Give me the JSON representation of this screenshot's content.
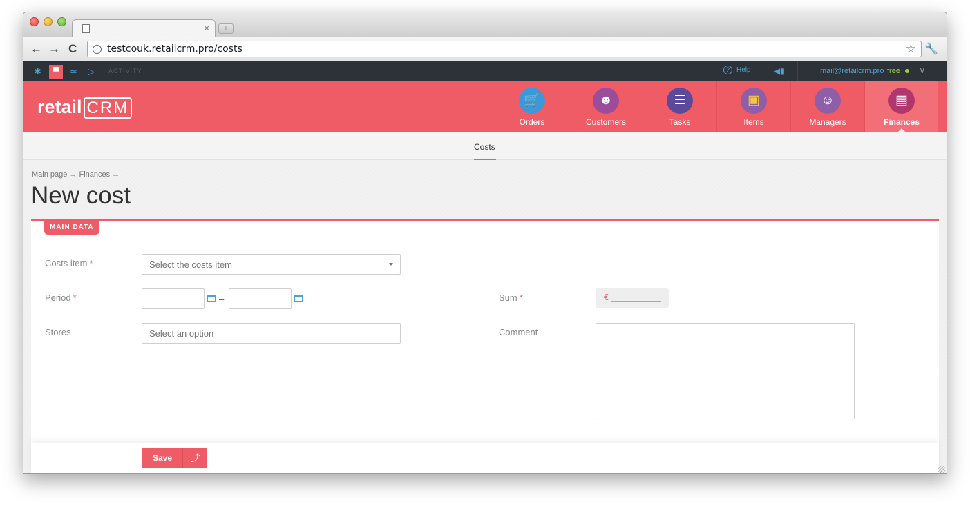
{
  "browser": {
    "url": "testcouk.retailcrm.pro/costs",
    "new_tab_glyph": "+",
    "close_glyph": "×"
  },
  "topbar": {
    "activity_label": "ACTIVITY",
    "help_label": "Help",
    "email": "mail@retailcrm.pro",
    "plan": "free",
    "accent_color": "#4aa3d8"
  },
  "header": {
    "logo_text": "retail",
    "logo_crm": "CRM",
    "brand_color": "#ef5c66",
    "nav": [
      {
        "label": "Orders",
        "icon": "cart-icon",
        "color": "#3a9ad9"
      },
      {
        "label": "Customers",
        "icon": "person-icon",
        "color": "#9b4d9b"
      },
      {
        "label": "Tasks",
        "icon": "chat-list-icon",
        "color": "#5b4a9c"
      },
      {
        "label": "Items",
        "icon": "box-icon",
        "color": "#8e5ea9"
      },
      {
        "label": "Managers",
        "icon": "manager-icon",
        "color": "#8e5ea9"
      },
      {
        "label": "Finances",
        "icon": "finance-list-icon",
        "color": "#b2366e"
      }
    ]
  },
  "subnav": {
    "costs": "Costs"
  },
  "page": {
    "breadcrumb": "Main page → Finances →",
    "title": "New cost",
    "section": "MAIN DATA"
  },
  "form": {
    "costs_item_label": "Costs item",
    "costs_item_placeholder": "Select the costs item",
    "period_label": "Period",
    "period_dash": "–",
    "stores_label": "Stores",
    "stores_placeholder": "Select an option",
    "sum_label": "Sum",
    "currency": "€",
    "comment_label": "Comment",
    "required_mark": "*"
  },
  "footer": {
    "save_label": "Save"
  }
}
